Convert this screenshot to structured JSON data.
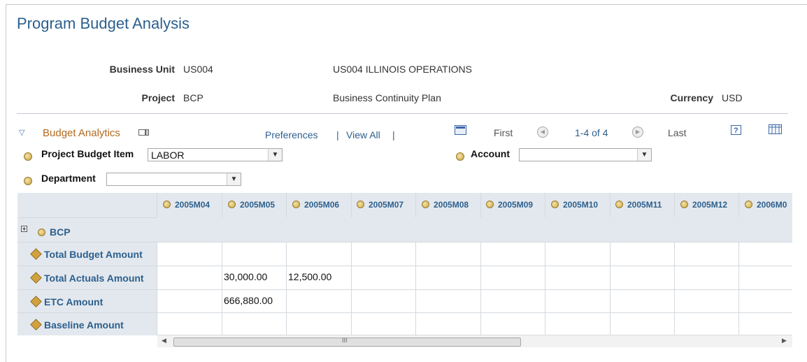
{
  "page": {
    "title": "Program Budget Analysis"
  },
  "header": {
    "business_unit_label": "Business Unit",
    "business_unit_value": "US004",
    "business_unit_desc": "US004 ILLINOIS OPERATIONS",
    "project_label": "Project",
    "project_value": "BCP",
    "project_desc": "Business Continuity Plan",
    "currency_label": "Currency",
    "currency_value": "USD"
  },
  "grid": {
    "title": "Budget Analytics",
    "preferences": "Preferences",
    "view_all": "View All",
    "separator": "|",
    "first": "First",
    "range": "1-4 of 4",
    "last": "Last"
  },
  "filters": {
    "project_budget_item_label": "Project Budget Item",
    "project_budget_item_value": "LABOR",
    "account_label": "Account",
    "account_value": "",
    "department_label": "Department",
    "department_value": ""
  },
  "table": {
    "periods": [
      "2005M04",
      "2005M05",
      "2005M06",
      "2005M07",
      "2005M08",
      "2005M09",
      "2005M10",
      "2005M11",
      "2005M12",
      "2006M0"
    ],
    "root_row": "BCP",
    "rows": [
      {
        "label": "Total Budget Amount",
        "values": [
          "",
          "",
          "",
          "",
          "",
          "",
          "",
          "",
          "",
          ""
        ]
      },
      {
        "label": "Total Actuals Amount",
        "values": [
          "",
          "30,000.00",
          "12,500.00",
          "",
          "",
          "",
          "",
          "",
          "",
          ""
        ]
      },
      {
        "label": "ETC Amount",
        "values": [
          "",
          "666,880.00",
          "",
          "",
          "",
          "",
          "",
          "",
          "",
          ""
        ]
      },
      {
        "label": "Baseline Amount",
        "values": [
          "",
          "",
          "",
          "",
          "",
          "",
          "",
          "",
          "",
          ""
        ]
      }
    ],
    "scroll_glyph": "III"
  },
  "icons": {
    "collapse": "triangle-down-icon",
    "expand": "plus-box-icon",
    "radio": "gold-radio-icon",
    "cube": "cube-icon"
  }
}
